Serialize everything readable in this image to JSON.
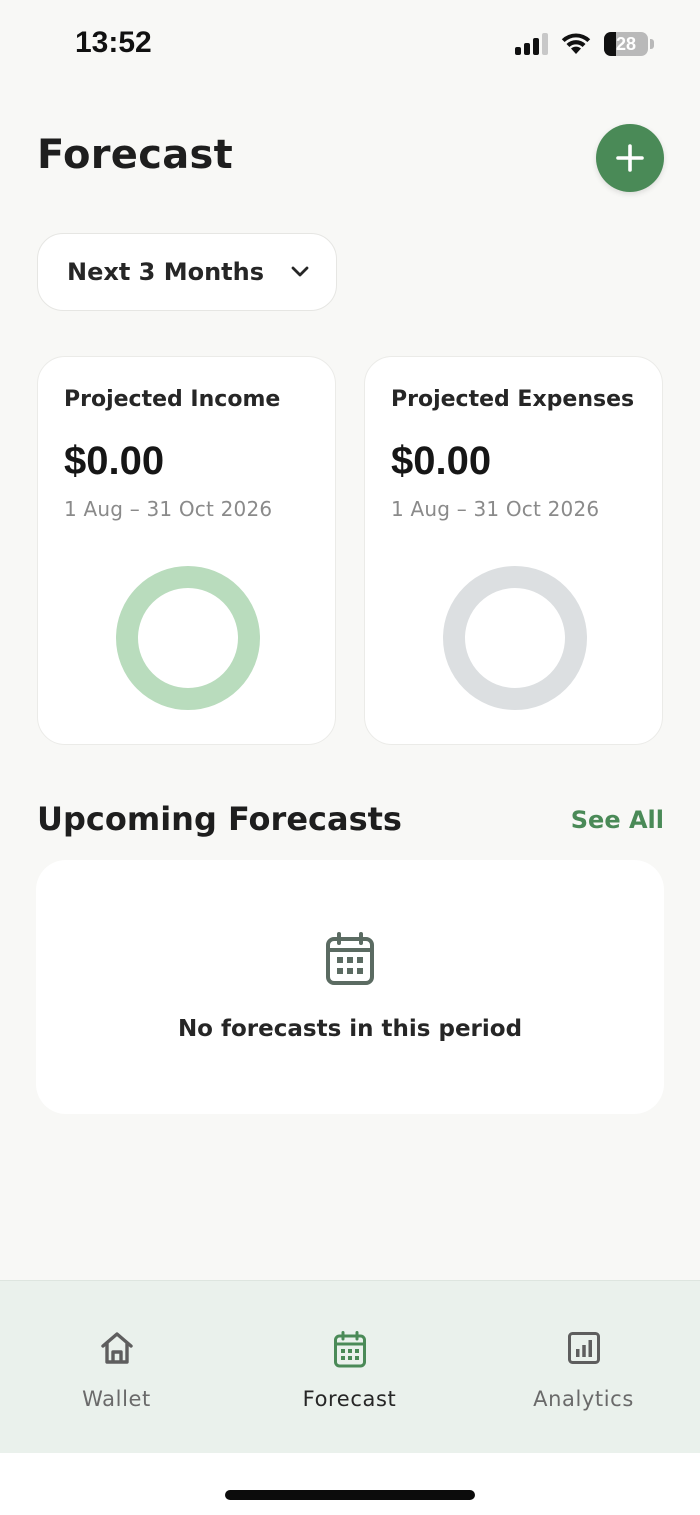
{
  "status_bar": {
    "time": "13:52",
    "battery_level": "28",
    "battery_fraction": 0.28
  },
  "header": {
    "title": "Forecast",
    "add_icon": "plus-icon",
    "accent_color": "#4a8a57"
  },
  "period_selector": {
    "selected": "Next 3 Months",
    "icon": "chevron-down-icon"
  },
  "summary_cards": [
    {
      "title": "Projected Income",
      "amount": "$0.00",
      "range": "1 Aug – 31 Oct 2026",
      "ring_color": "#b9dcbd"
    },
    {
      "title": "Projected Expenses",
      "amount": "$0.00",
      "range": "1 Aug – 31 Oct 2026",
      "ring_color": "#dcdfe1"
    }
  ],
  "upcoming": {
    "title": "Upcoming Forecasts",
    "see_all": "See All",
    "empty_icon": "calendar-icon",
    "empty_message": "No forecasts in this period"
  },
  "bottom_nav": {
    "items": [
      {
        "label": "Wallet",
        "icon": "home-icon",
        "active": false
      },
      {
        "label": "Forecast",
        "icon": "calendar-icon",
        "active": true
      },
      {
        "label": "Analytics",
        "icon": "chart-icon",
        "active": false
      }
    ],
    "active_color": "#4a8a57",
    "inactive_color": "#5e5e5e"
  }
}
